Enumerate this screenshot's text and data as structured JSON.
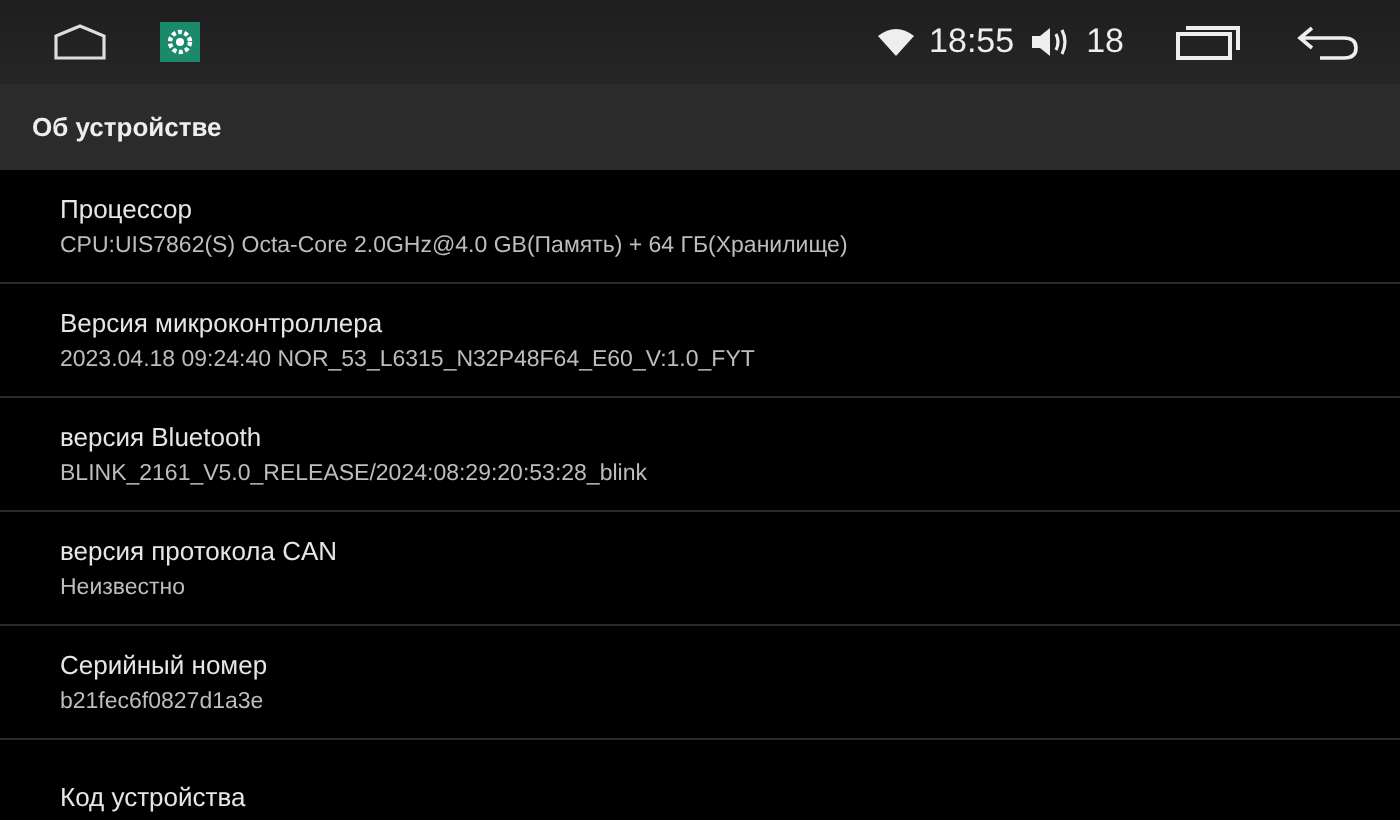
{
  "status_bar": {
    "time": "18:55",
    "volume": "18"
  },
  "header": {
    "title": "Об устройстве"
  },
  "items": [
    {
      "title": "Процессор",
      "value": "CPU:UIS7862(S) Octa-Core 2.0GHz@4.0 GB(Память) + 64 ГБ(Хранилище)"
    },
    {
      "title": "Версия микроконтроллера",
      "value": "2023.04.18 09:24:40 NOR_53_L6315_N32P48F64_E60_V:1.0_FYT"
    },
    {
      "title": "версия Bluetooth",
      "value": "BLINK_2161_V5.0_RELEASE/2024:08:29:20:53:28_blink"
    },
    {
      "title": "версия протокола CAN",
      "value": "Неизвестно"
    },
    {
      "title": "Серийный номер",
      "value": "b21fec6f0827d1a3e"
    },
    {
      "title": "Код устройства"
    }
  ]
}
